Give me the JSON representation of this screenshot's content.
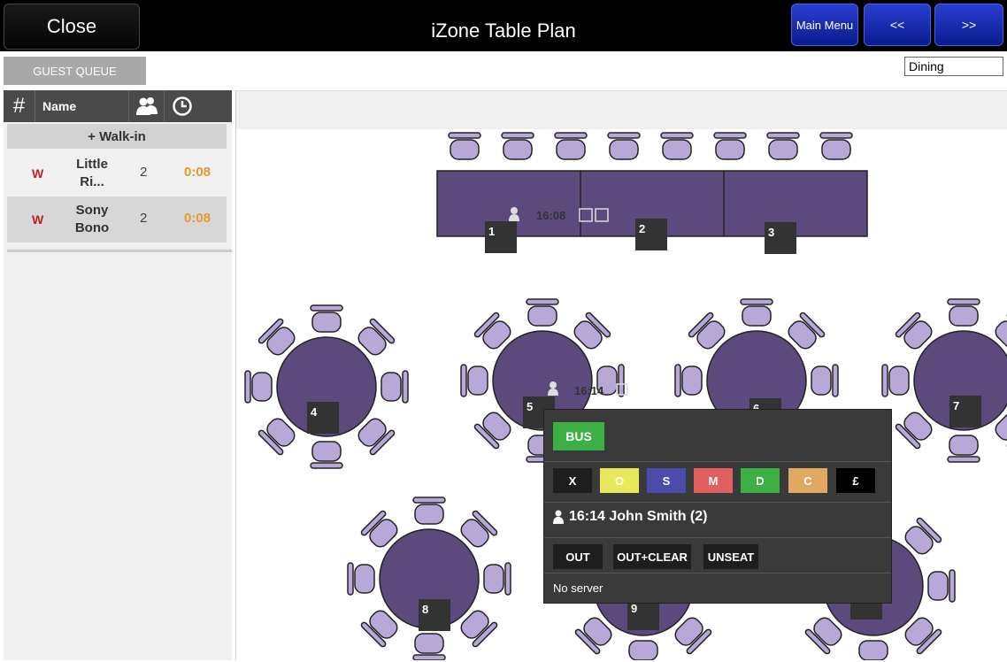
{
  "header": {
    "close_label": "Close",
    "title": "iZone Table Plan",
    "main_menu_label": "Main Menu",
    "prev_label": "<<",
    "next_label": ">>"
  },
  "toolbar": {
    "guest_queue_label": "GUEST QUEUE",
    "area_select_value": "Dining"
  },
  "queue": {
    "columns": {
      "number": "#",
      "name": "Name"
    },
    "walkin_label": "+ Walk-in",
    "rows": [
      {
        "type": "W",
        "name_line1": "Little",
        "name_line2": "Ri...",
        "covers": "2",
        "wait": "0:08"
      },
      {
        "type": "W",
        "name_line1": "Sony",
        "name_line2": "Bono",
        "covers": "2",
        "wait": "0:08"
      }
    ]
  },
  "tables": [
    {
      "number": "1",
      "shape": "rect",
      "reservation_time": "16:08"
    },
    {
      "number": "2",
      "shape": "rect"
    },
    {
      "number": "3",
      "shape": "rect"
    },
    {
      "number": "4",
      "shape": "round"
    },
    {
      "number": "5",
      "shape": "round",
      "reservation_time": "16:14"
    },
    {
      "number": "6",
      "shape": "round"
    },
    {
      "number": "7",
      "shape": "round"
    },
    {
      "number": "8",
      "shape": "round"
    },
    {
      "number": "9",
      "shape": "round"
    }
  ],
  "popup": {
    "bus_label": "BUS",
    "status_buttons": [
      {
        "label": "X",
        "color": "#1e1e1e"
      },
      {
        "label": "O",
        "color": "#e8e85a"
      },
      {
        "label": "S",
        "color": "#4b4bab"
      },
      {
        "label": "M",
        "color": "#e06060"
      },
      {
        "label": "D",
        "color": "#3cb043"
      },
      {
        "label": "C",
        "color": "#e0a860"
      },
      {
        "label": "£",
        "color": "#000000"
      }
    ],
    "reservation": "16:14 John Smith (2)",
    "actions": {
      "out": "OUT",
      "out_clear": "OUT+CLEAR",
      "unseat": "UNSEAT"
    },
    "server": "No server"
  },
  "colors": {
    "table_fill": "#5d4a7c",
    "chair_fill": "#b8a8d8",
    "nav_blue": "#1a2fb8",
    "wait_orange": "#e39b2c"
  }
}
